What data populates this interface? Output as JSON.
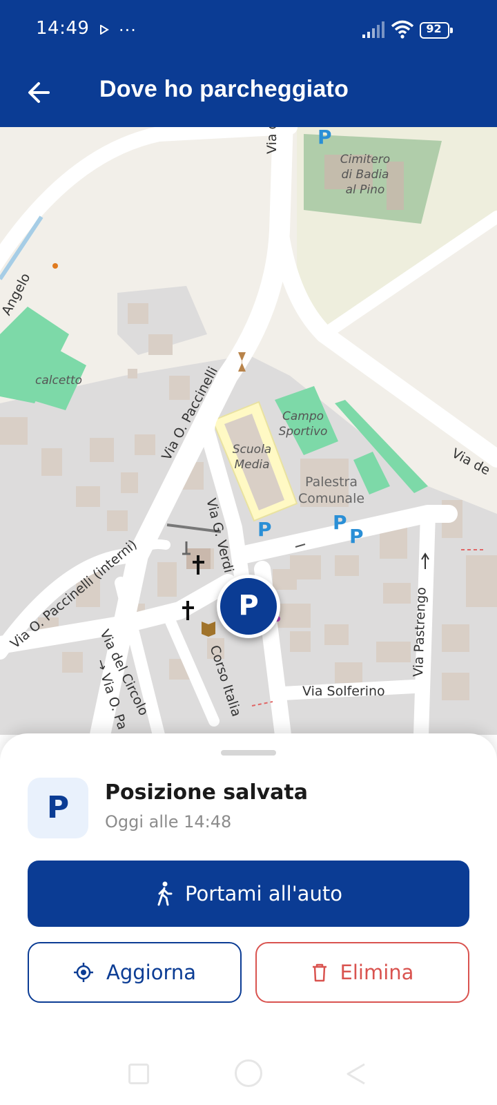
{
  "status_bar": {
    "time": "14:49",
    "more": "···",
    "battery_level": "92",
    "icons": [
      "play-icon",
      "signal-icon",
      "wifi-icon",
      "battery-icon"
    ]
  },
  "app_bar": {
    "title": "Dove ho parcheggiato",
    "back_icon": "arrow-left-icon"
  },
  "map": {
    "areas": {
      "cemetery": "Cimitero\ndi Badia\nal Pino",
      "calcetto": "calcetto",
      "campo": "Campo\nSportivo",
      "scuola": "Scuola\nMedia",
      "palestra": "Palestra\nComunale"
    },
    "streets": {
      "via_d_top": "Via d",
      "via_angelo": "Angelo",
      "via_paccinelli": "Via O. Paccinelli",
      "via_de": "Via de",
      "via_paccinelli_interni": "Via O. Paccinelli (interni)",
      "via_verdi": "Via G. Verdi",
      "via_circolo": "Via del Circolo",
      "via_pa": "→ Via O. Pa",
      "corso_italia": "Corso Italia",
      "via_pastrengo": "Via Pastrengo",
      "via_solferino": "Via Solferino"
    },
    "parking_symbol": "P",
    "pin_label": "P"
  },
  "sheet": {
    "badge": "P",
    "title": "Posizione salvata",
    "subtitle": "Oggi alle 14:48",
    "primary_button": "Portami all'auto",
    "update_button": "Aggiorna",
    "delete_button": "Elimina"
  },
  "colors": {
    "brand": "#0b3c94",
    "danger": "#d9534f",
    "badge_bg": "#e9f1fc",
    "map_park": "#7dd9a8",
    "map_building": "#d9cfc6",
    "map_road": "#ffffff"
  }
}
